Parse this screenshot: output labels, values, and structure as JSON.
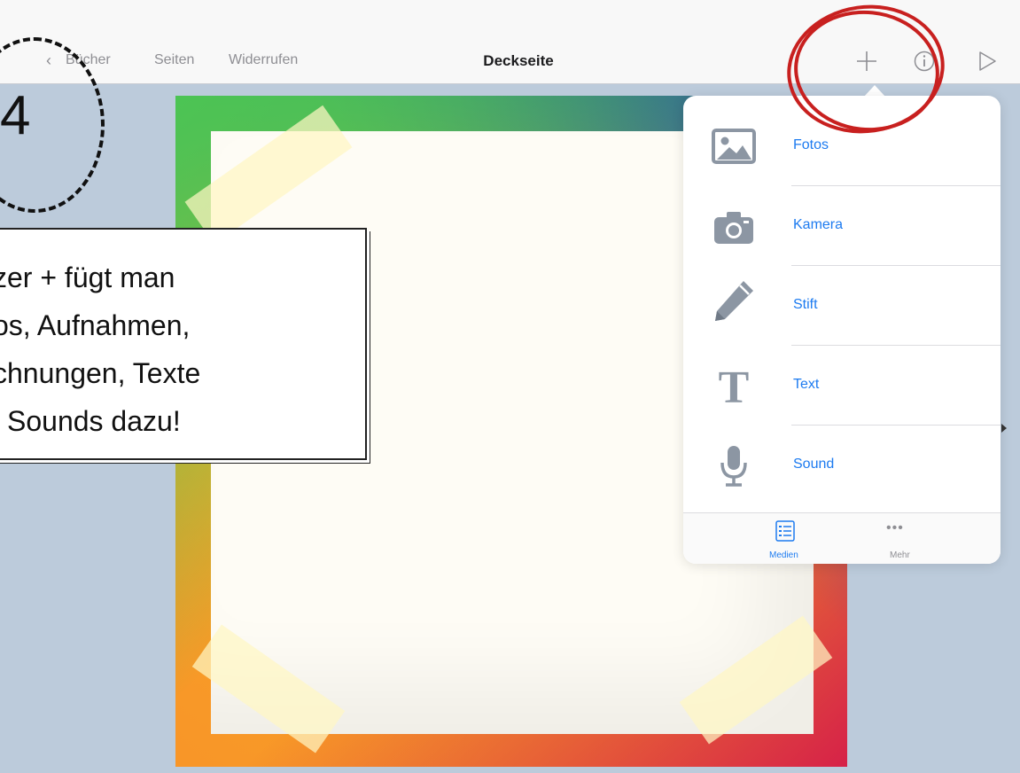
{
  "topbar": {
    "back_label": "Bücher",
    "pages_label": "Seiten",
    "undo_label": "Widerrufen",
    "title": "Deckseite",
    "actions": [
      "plus-icon",
      "info-icon",
      "play-icon"
    ]
  },
  "annotation": {
    "step_number": "4",
    "lines": [
      "zer + fügt man",
      "os, Aufnahmen,",
      "chnungen, Texte",
      "l Sounds dazu!"
    ]
  },
  "popover": {
    "items": [
      {
        "label": "Fotos",
        "icon": "photo-icon"
      },
      {
        "label": "Kamera",
        "icon": "camera-icon"
      },
      {
        "label": "Stift",
        "icon": "pen-icon"
      },
      {
        "label": "Text",
        "icon": "text-icon"
      },
      {
        "label": "Sound",
        "icon": "microphone-icon"
      }
    ],
    "tabs": [
      {
        "label": "Medien",
        "icon": "list-icon",
        "active": true
      },
      {
        "label": "Mehr",
        "icon": "more-icon",
        "active": false
      }
    ]
  },
  "colors": {
    "accent": "#1d7bf0",
    "icon_gray": "#8c96a3",
    "highlight_red": "#c8201f",
    "background": "#bccbdb"
  }
}
